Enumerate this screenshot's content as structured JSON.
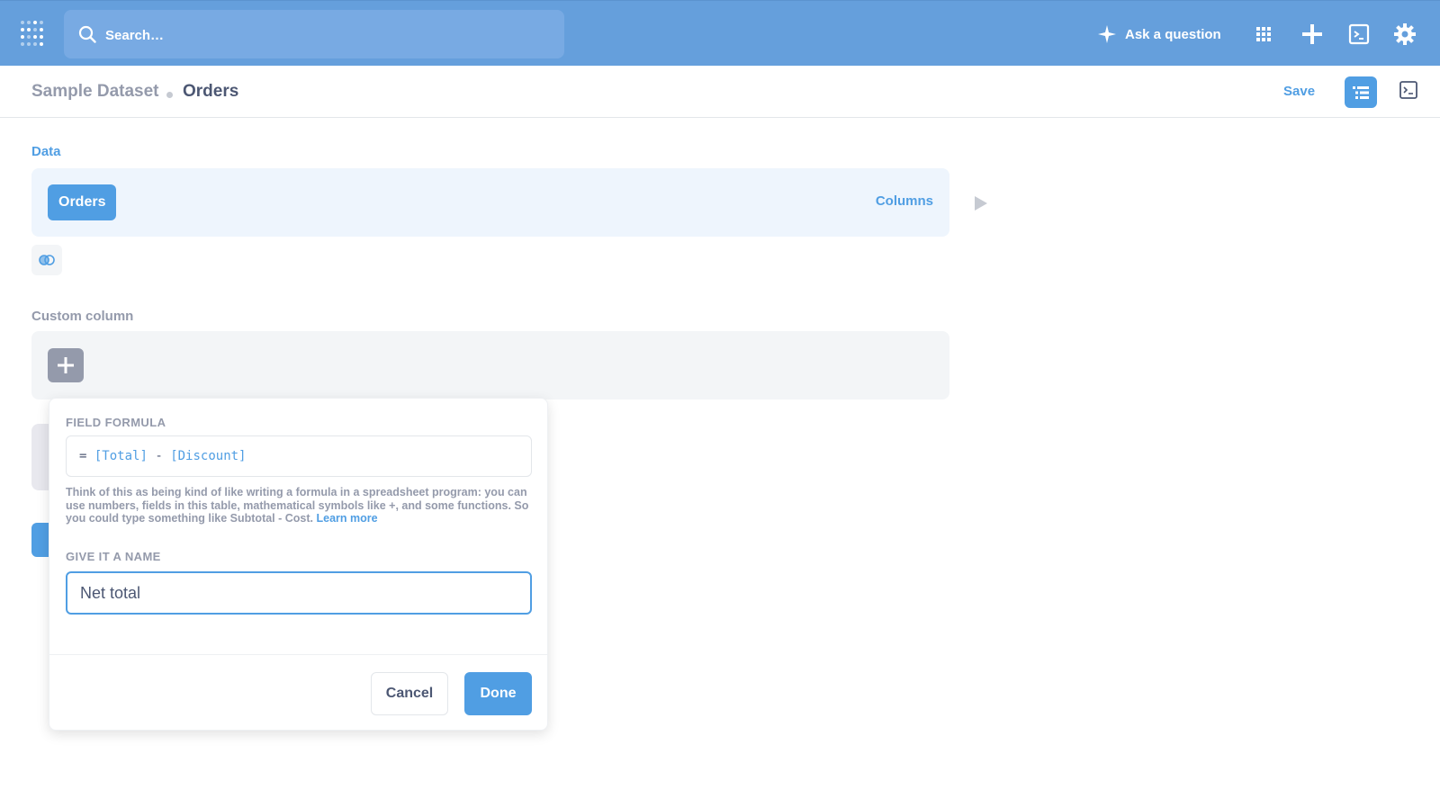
{
  "topbar": {
    "logo_icon": "metabase-logo-icon",
    "search": {
      "placeholder": "Search…",
      "value": ""
    },
    "ask_label": "Ask a question",
    "icons": [
      "apps-grid-icon",
      "plus-icon",
      "sql-editor-icon",
      "gear-icon"
    ]
  },
  "breadcrumb": {
    "dataset": "Sample Dataset",
    "table": "Orders"
  },
  "header_actions": {
    "save_label": "Save"
  },
  "data_step": {
    "label": "Data",
    "table_pill": "Orders",
    "columns_link": "Columns"
  },
  "custom_column_step": {
    "label": "Custom column"
  },
  "popover": {
    "formula_label": "FIELD FORMULA",
    "formula": {
      "prefix": "=",
      "field1": "[Total]",
      "operator": "-",
      "field2": "[Discount]"
    },
    "help_text": "Think of this as being kind of like writing a formula in a spreadsheet program: you can use numbers, fields in this table, mathematical symbols like +, and some functions. So you could type something like Subtotal - Cost.",
    "learn_more": "Learn more",
    "name_label": "GIVE IT A NAME",
    "name_value": "Net total",
    "cancel_label": "Cancel",
    "done_label": "Done"
  },
  "colors": {
    "brand": "#509ee3",
    "nav_bg": "#659fdc",
    "text_dark": "#4c5773",
    "text_light": "#949aab"
  }
}
